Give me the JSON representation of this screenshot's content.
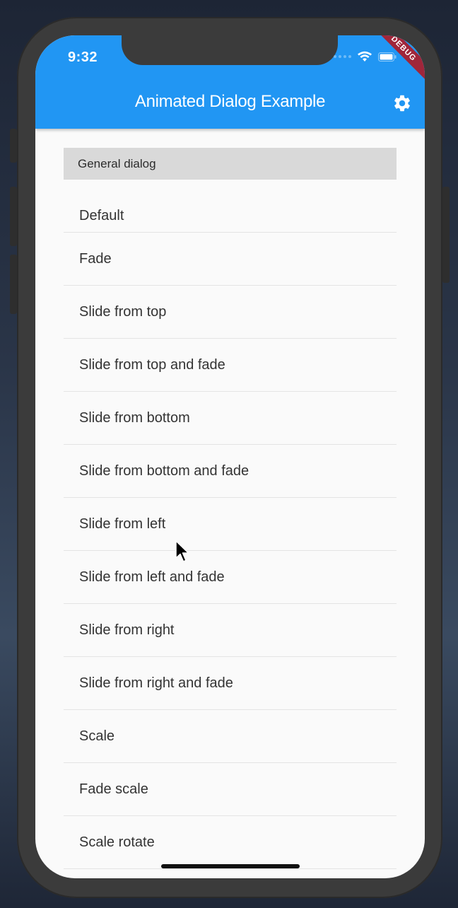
{
  "status_bar": {
    "time": "9:32",
    "debug_label": "DEBUG"
  },
  "app_bar": {
    "title": "Animated Dialog Example",
    "action_icon": "settings-icon",
    "color": "#2196f3"
  },
  "section": {
    "header": "General dialog"
  },
  "items": [
    {
      "label": "Default"
    },
    {
      "label": "Fade"
    },
    {
      "label": "Slide from top"
    },
    {
      "label": "Slide from top and fade"
    },
    {
      "label": "Slide from bottom"
    },
    {
      "label": "Slide from bottom and fade"
    },
    {
      "label": "Slide from left"
    },
    {
      "label": "Slide from left and fade"
    },
    {
      "label": "Slide from right"
    },
    {
      "label": "Slide from right and fade"
    },
    {
      "label": "Scale"
    },
    {
      "label": "Fade scale"
    },
    {
      "label": "Scale rotate"
    }
  ]
}
